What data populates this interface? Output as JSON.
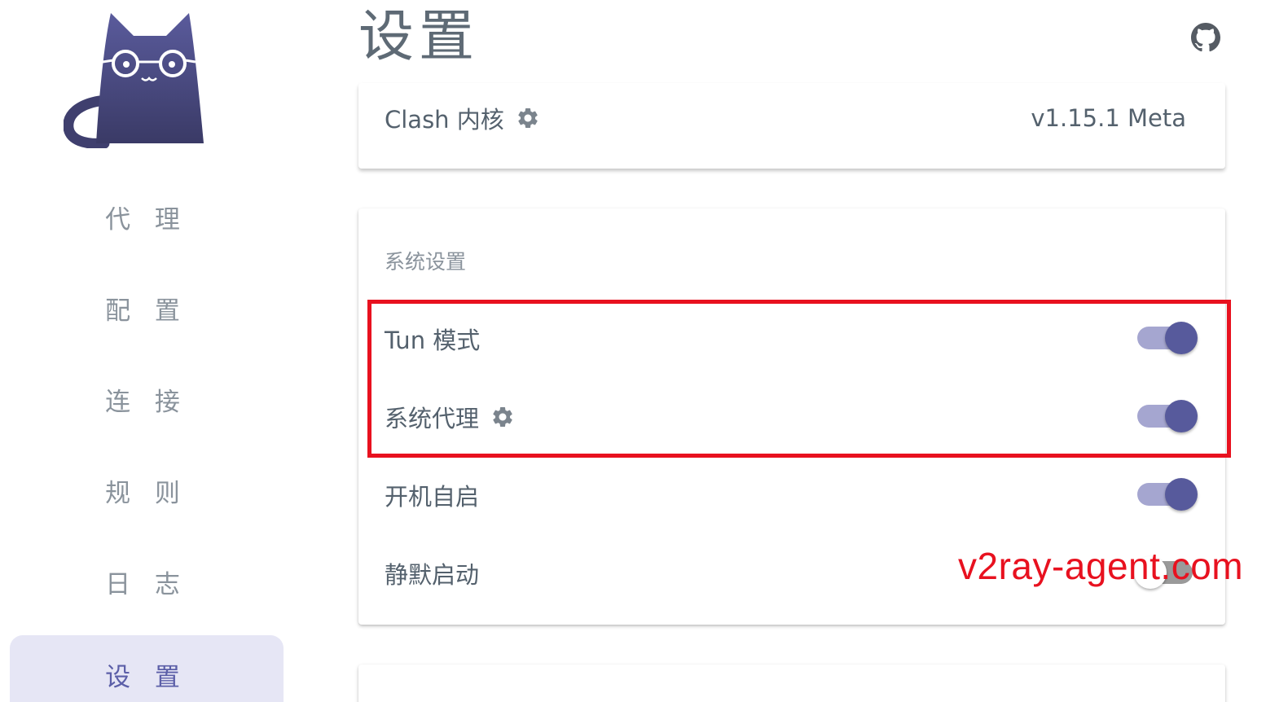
{
  "colors": {
    "accent": "#575a9c",
    "accent_light": "#a5a6d0",
    "nav_active_bg": "#e6e6f5",
    "highlight": "#e8111f",
    "text": "#54616d",
    "muted": "#8a939c"
  },
  "sidebar": {
    "logo": "cat-logo",
    "items": [
      {
        "label": "代 理",
        "active": false
      },
      {
        "label": "配 置",
        "active": false
      },
      {
        "label": "连 接",
        "active": false
      },
      {
        "label": "规 则",
        "active": false
      },
      {
        "label": "日 志",
        "active": false
      },
      {
        "label": "设 置",
        "active": true
      }
    ]
  },
  "header": {
    "title": "设置",
    "github_icon": "github-icon"
  },
  "clash_card": {
    "label": "Clash 内核",
    "gear_icon": "gear-icon",
    "value": "v1.15.1 Meta"
  },
  "system_card": {
    "section_title": "系统设置",
    "rows": [
      {
        "label": "Tun 模式",
        "has_gear": false,
        "enabled": true
      },
      {
        "label": "系统代理",
        "has_gear": true,
        "enabled": true
      },
      {
        "label": "开机自启",
        "has_gear": false,
        "enabled": true
      },
      {
        "label": "静默启动",
        "has_gear": false,
        "enabled": false
      }
    ]
  },
  "watermark": "v2ray-agent.com"
}
